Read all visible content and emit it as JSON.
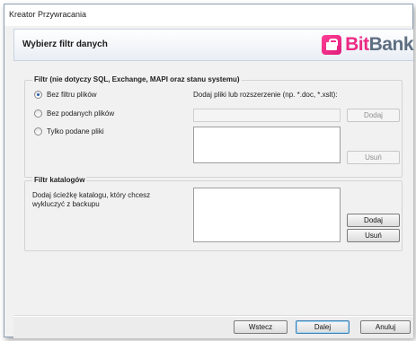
{
  "window": {
    "title": "Kreator Przywracania"
  },
  "header": {
    "page_title": "Wybierz filtr danych",
    "logo_prefix": "Bit",
    "logo_suffix": "Bank"
  },
  "file_filter": {
    "legend": "Filtr (nie dotyczy SQL, Exchange, MAPI oraz stanu systemu)",
    "options": [
      "Bez filtru plików",
      "Bez podanych plików",
      "Tylko podane pliki"
    ],
    "selected_index": 0,
    "extension_prompt": "Dodaj pliki lub rozszerzenie  (np. *.doc, *.xslt):",
    "extension_value": "",
    "add_label": "Dodaj",
    "remove_label": "Usuń"
  },
  "dir_filter": {
    "legend": "Filtr katalogów",
    "description": "Dodaj ścieżkę katalogu, który chcesz wykluczyć z backupu",
    "add_label": "Dodaj",
    "remove_label": "Usuń"
  },
  "footer": {
    "back_label": "Wstecz",
    "next_label": "Dalej",
    "cancel_label": "Anuluj"
  }
}
